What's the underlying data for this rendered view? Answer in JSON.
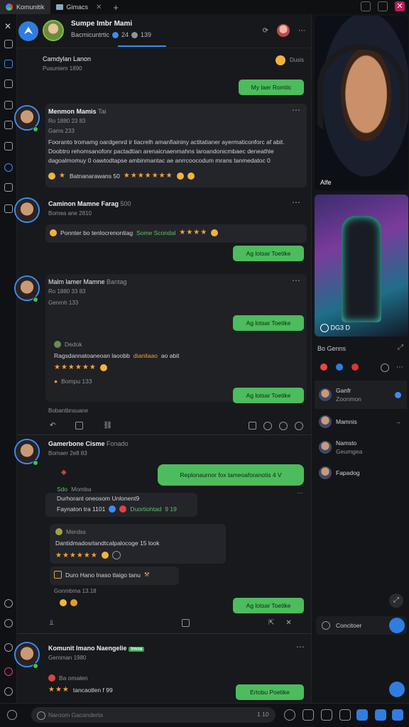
{
  "tabs": [
    {
      "label": "Komunitik",
      "active": true
    },
    {
      "label": "Gimacs",
      "active": false
    }
  ],
  "header": {
    "title": "Sumpe Imbr Mami",
    "subtitle": "Bacmicuntrtic",
    "count_a": "24",
    "count_b": "139"
  },
  "feed": {
    "top_author": "Camdylan Lanon",
    "top_author_meta": "Pusuniem 1890",
    "top_reply_label": "Dusis",
    "top_cta": "My laer Romtic",
    "posts": [
      {
        "author": "Menmon Mamis",
        "author_tag": "Tai",
        "meta": "Ro 1880 23 83",
        "meta2": "Gams 233",
        "body": "Fooranto tromamg oardgenrd ir tiacrelh amanfiaininy actitatianer ayermaticonforc af abit. Doobtro rehomsanofonr pactadtian arenaicnaenmahns laroandonicmbaec deneathle dagoalmomuy 0 oawtodtapse ambinmantac ae anrrcoocodum mrans tanmedatoc 0",
        "reactions_label": "Batnanarawans 50",
        "rating": "★★★★★★★"
      },
      {
        "author": "Caminon Mamne Farag",
        "author_tag": "500",
        "meta": "Bomea ane 2810",
        "body": "Ponnter bo tenlocrenontiag",
        "highlight": "Some Scondal",
        "rating": "★★★★",
        "cta": "Ag lotsar Toetike"
      },
      {
        "author": "Malm lamer Mamne",
        "author_tag": "Bantag",
        "meta": "Ro 1880 33 83",
        "meta2": "Genrnh 133",
        "cta1": "Ag lotsar Toetike",
        "sub_author": "Dedok",
        "sub_body": "Ragsdannatoaneoan laoobb",
        "sub_highlight": "dianilaao",
        "sub_tail": "ao abit",
        "rating": "★★★★★★",
        "sub_meta": "Bompu 133",
        "cta2": "Ag lotsar Toetike",
        "footer": "Bobantbnsuane",
        "actions": [
          "Reply",
          "Share",
          "Link"
        ]
      },
      {
        "author": "Gamerbone Cisme",
        "author_tag": "Fonado",
        "meta": "Bomaer 2e8 83",
        "bubble": "Replonaurnor fox lameoaforanotis 4 V",
        "green_label": "Sdo",
        "green_meta": "Momba",
        "line1": "Durhorant oneosom Unlonent9",
        "line2_a": "Faynaton tra 1101",
        "line2_b": "Duortiohtad",
        "line2_c": "9 19",
        "quote_author": "Merdss",
        "quote_body": "Dantidmadosrlandtcalpalocoge 15 look",
        "quote_rating": "★★★★★★",
        "tip": "Duro Hano Inaso tlaigo tanu",
        "tip_meta": "Gonmbma 13.18",
        "cta": "Ag lotsar Toetike"
      },
      {
        "author": "Komunit Imano Naengelie",
        "badge": "Imna",
        "meta": "Gernman 1980",
        "reply_label": "Ba omalen",
        "rating": "★★★",
        "rating_text": "tancaotlen f 99",
        "cta": "Ertobu Poetike"
      }
    ]
  },
  "right_panel": {
    "video1_label": "Alfe",
    "video2_label": "DG3 D",
    "section_title": "Bo Genns",
    "items": [
      {
        "name": "Ganfr",
        "sub": "Zoonmon",
        "selected": true
      },
      {
        "name": "Mamnis",
        "sub": "",
        "selected": false
      },
      {
        "name": "Namsto",
        "sub": "Geumgea",
        "selected": false
      },
      {
        "name": "Fapadog",
        "sub": "",
        "selected": false
      }
    ],
    "connect_label": "Concitoer"
  },
  "composer": {
    "placeholder": "Naroom Gacanderta",
    "counter": "1 10"
  },
  "colors": {
    "accent": "#2f7de1",
    "cta_green": "#4cbc5d",
    "star": "#f0a23a",
    "background": "#18191c"
  }
}
